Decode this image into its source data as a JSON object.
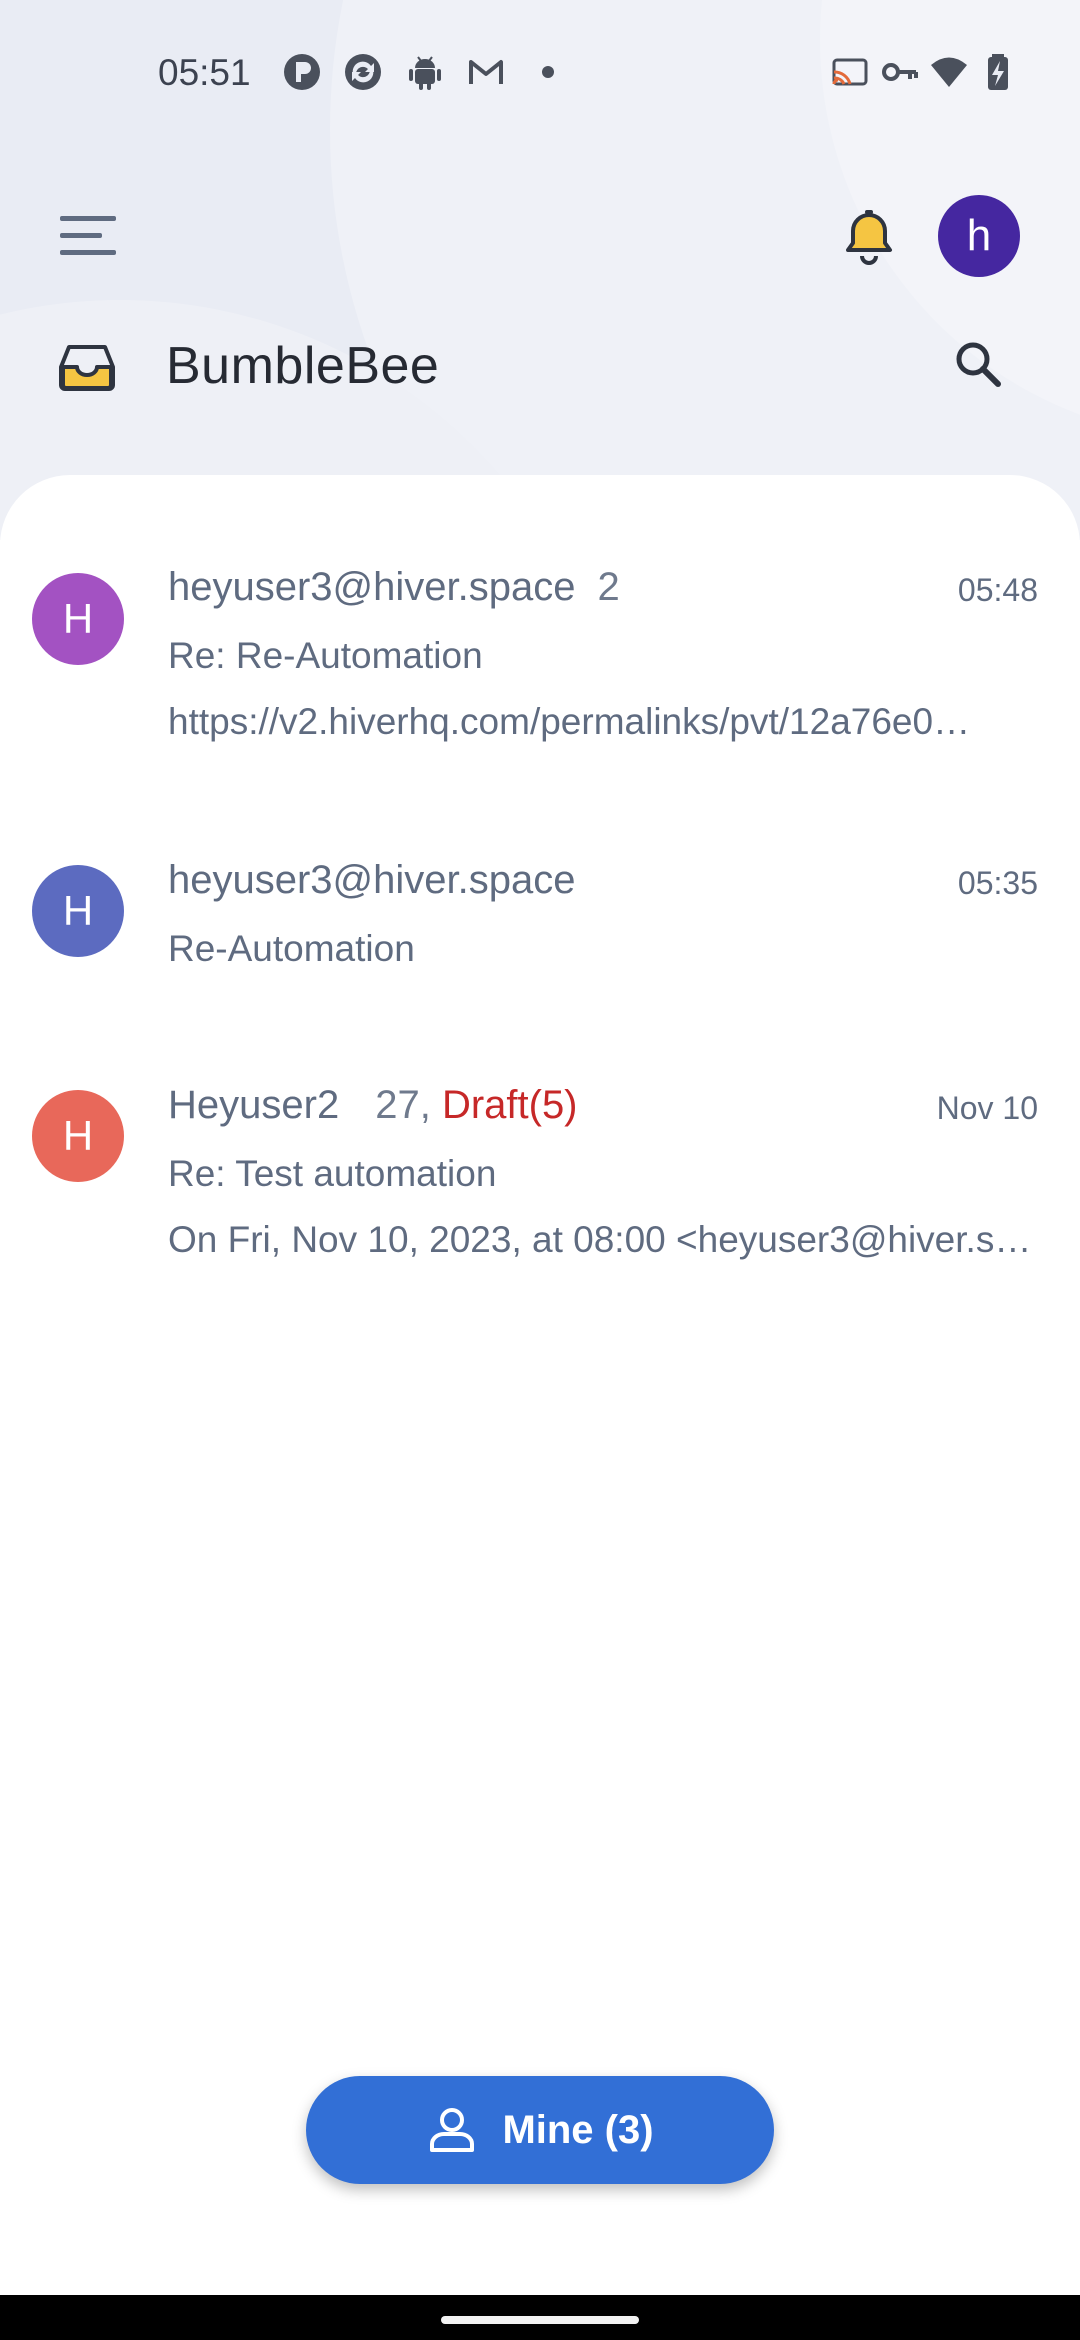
{
  "status_bar": {
    "time": "05:51",
    "left_icons": [
      "p-badge-icon",
      "sync-app-icon",
      "android-icon",
      "gmail-icon",
      "dot-icon"
    ],
    "right_icons": [
      "cast-icon",
      "vpn-key-icon",
      "wifi-icon",
      "battery-charging-icon"
    ]
  },
  "app_bar": {
    "user_initial": "h",
    "user_avatar_color": "#4527a0",
    "inbox_name": "BumbleBee",
    "inbox_icon_color": "#f5c542"
  },
  "threads": [
    {
      "initial": "H",
      "avatar_color": "#a352c2",
      "from": "heyuser3@hiver.space",
      "count": "2",
      "draft": "",
      "time": "05:48",
      "subject": "Re: Re-Automation",
      "snippet": "https://v2.hiverhq.com/permalinks/pvt/12a76e0…"
    },
    {
      "initial": "H",
      "avatar_color": "#5c6bc0",
      "from": "heyuser3@hiver.space",
      "count": "",
      "draft": "",
      "time": "05:35",
      "subject": "Re-Automation",
      "snippet": ""
    },
    {
      "initial": "H",
      "avatar_color": "#e8685a",
      "from": "Heyuser2",
      "count": "27,",
      "draft": "Draft(5)",
      "time": "Nov 10",
      "subject": "Re: Test automation",
      "snippet": "On Fri, Nov 10, 2023, at 08:00 <heyuser3@hiver.s…"
    }
  ],
  "fab": {
    "label": "Mine (3)",
    "color": "#326fd6"
  }
}
